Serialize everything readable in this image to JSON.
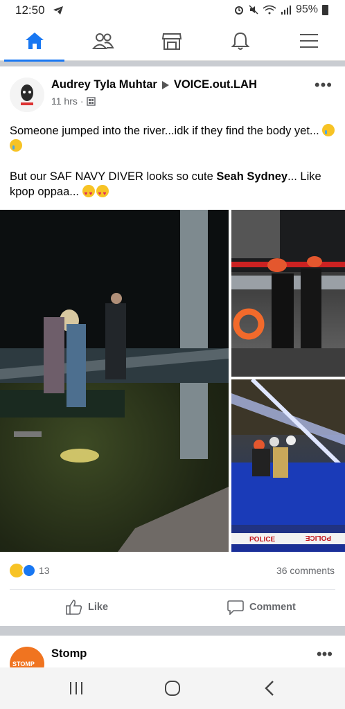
{
  "status": {
    "time": "12:50",
    "battery": "95%"
  },
  "nav": {
    "items": [
      "home-icon",
      "friends-icon",
      "marketplace-icon",
      "notifications-icon",
      "menu-icon"
    ]
  },
  "post": {
    "author": "Audrey Tyla Muhtar",
    "page": "VOICE.out.LAH",
    "time": "11 hrs",
    "text_line1": "Someone jumped into the river...idk if they find the body yet...",
    "text_line2_prefix": "But our SAF NAVY DIVER looks so cute ",
    "text_line2_bold": "Seah Sydney",
    "text_line2_suffix": "... Like kpop oppaa...",
    "reaction_count": "13",
    "comments": "36 comments",
    "like_label": "Like",
    "comment_label": "Comment",
    "tape_text": "POLICE"
  },
  "post2": {
    "author": "Stomp",
    "avatar_text": "STOMP"
  },
  "colors": {
    "accent": "#1877f2",
    "feed_bg": "#c9ccd1",
    "muted": "#65676b"
  }
}
